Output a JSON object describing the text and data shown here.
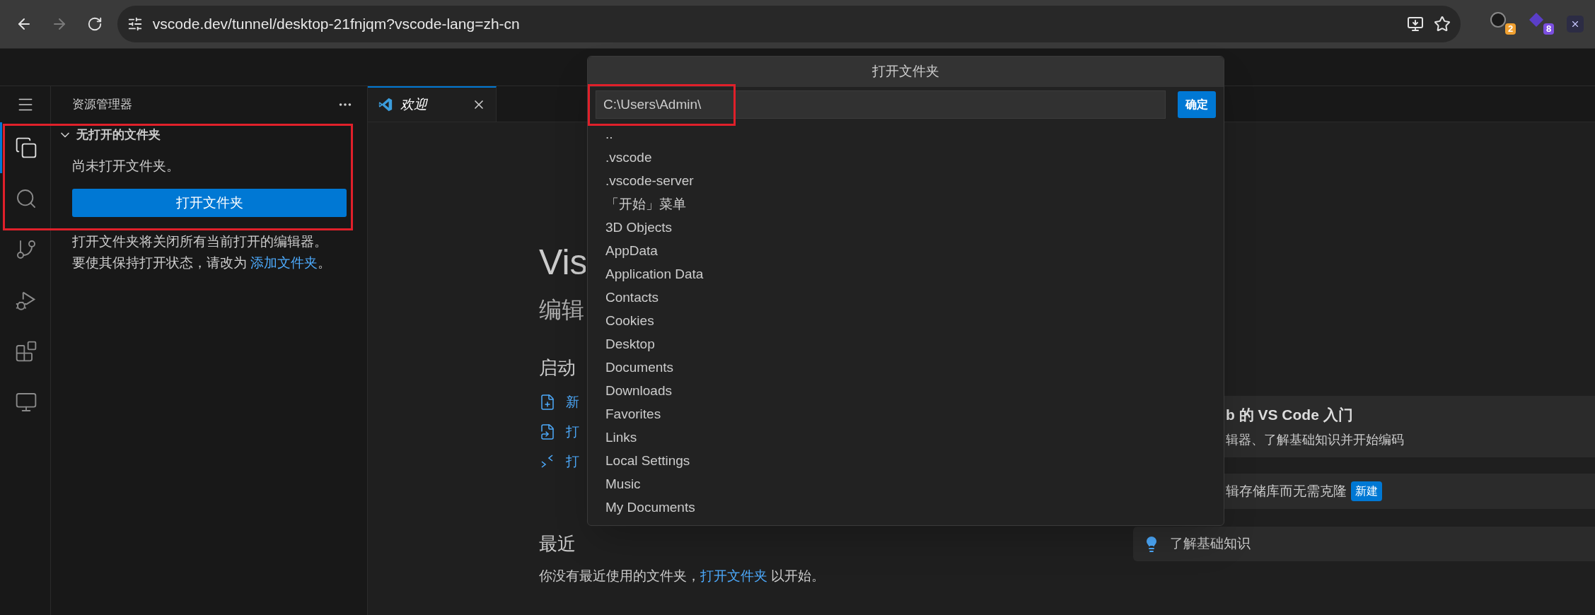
{
  "browser": {
    "url": "vscode.dev/tunnel/desktop-21fnjqm?vscode-lang=zh-cn",
    "forward_disabled": true,
    "extensions": [
      {
        "badge": "2",
        "color": "#f0a030"
      },
      {
        "badge": "8",
        "color": "#7b4fe0"
      }
    ]
  },
  "activity_bar": [
    {
      "selected": true
    },
    {
      "selected": false
    },
    {
      "selected": false
    },
    {
      "selected": false
    },
    {
      "selected": false
    },
    {
      "selected": false
    }
  ],
  "sidebar": {
    "title": "资源管理器",
    "section": {
      "title": "无打开的文件夹",
      "expanded": true
    },
    "message": "尚未打开文件夹。",
    "button": "打开文件夹",
    "note": "打开文件夹将关闭所有当前打开的编辑器。要使其保持打开状态，请改为 ",
    "note_link": "添加文件夹",
    "note_end": "。"
  },
  "tabs": [
    {
      "label": "欢迎",
      "selected": true
    }
  ],
  "welcome": {
    "title": "Vis",
    "subtitle": "编辑",
    "start_heading": "启动",
    "start_items": [
      {
        "kind": "new-file",
        "label": "新"
      },
      {
        "kind": "open-file",
        "label": "打"
      },
      {
        "kind": "remote",
        "label": "打"
      }
    ],
    "recent_heading": "最近",
    "recent_text": "你没有最近使用的文件夹，",
    "recent_link": "打开文件夹",
    "recent_end": " 以开始。"
  },
  "walkthroughs": [
    {
      "kind": "featured",
      "title": "b 的 VS Code 入门",
      "description": "辑器、了解基础知识并开始编码"
    },
    {
      "kind": "badge",
      "title": "辑存储库而无需克隆",
      "badge": "新建"
    },
    {
      "kind": "icon",
      "title": "了解基础知识"
    }
  ],
  "dialog": {
    "title": "打开文件夹",
    "value": "C:\\Users\\Admin\\",
    "ok": "确定",
    "items": [
      "..",
      ".vscode",
      ".vscode-server",
      "「开始」菜单",
      "3D Objects",
      "AppData",
      "Application Data",
      "Contacts",
      "Cookies",
      "Desktop",
      "Documents",
      "Downloads",
      "Favorites",
      "Links",
      "Local Settings",
      "Music",
      "My Documents"
    ]
  }
}
